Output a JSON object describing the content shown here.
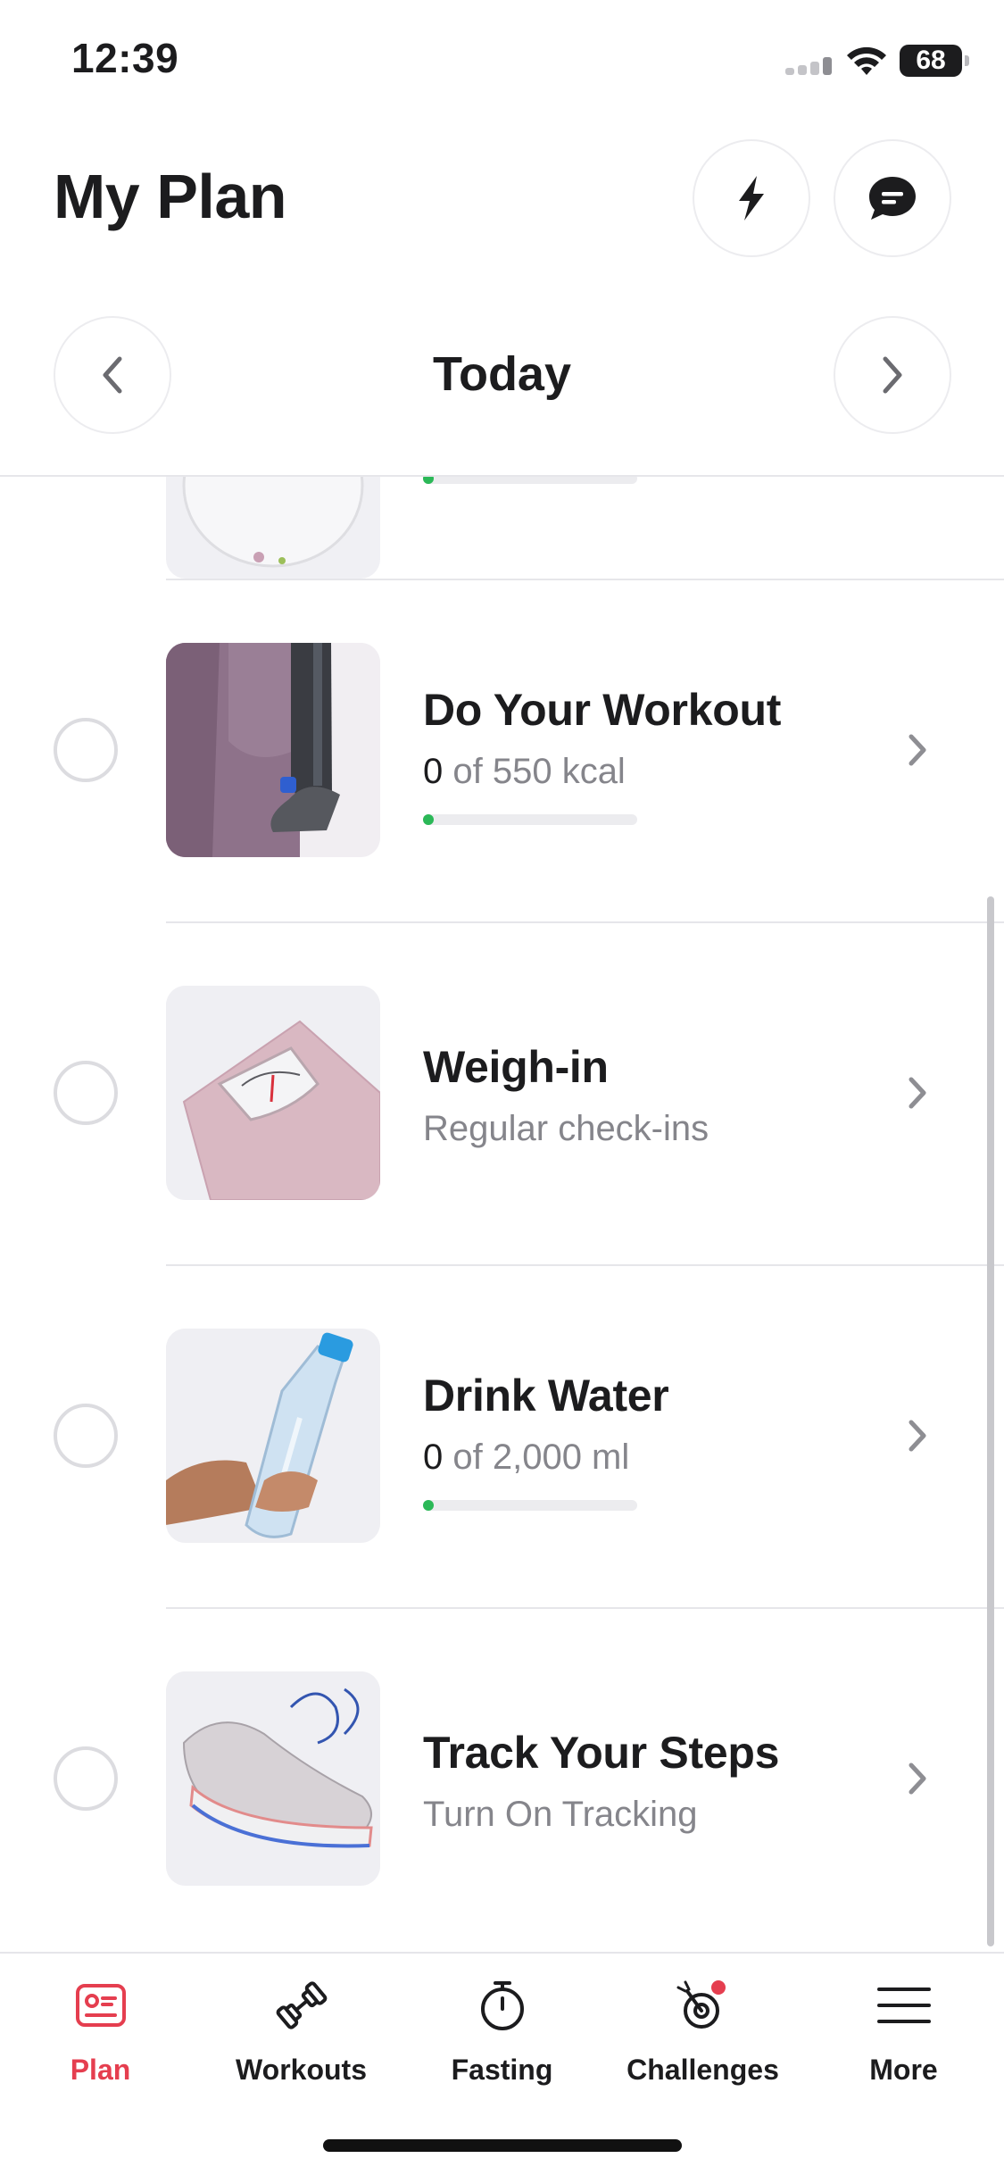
{
  "status_bar": {
    "time": "12:39",
    "battery": "68"
  },
  "header": {
    "title": "My Plan",
    "date_label": "Today"
  },
  "tasks": [
    {
      "title": "Do Your Workout",
      "value": "0",
      "sub_rest": " of 550 kcal",
      "progress": 0,
      "image": "prosthetic-leg-workout"
    },
    {
      "title": "Weigh-in",
      "subtitle": "Regular check-ins",
      "image": "weighing-scale"
    },
    {
      "title": "Drink Water",
      "value": "0",
      "sub_rest": " of 2,000 ml",
      "progress": 0,
      "image": "water-bottle"
    },
    {
      "title": "Track Your Steps",
      "subtitle": "Turn On Tracking",
      "image": "sneaker"
    }
  ],
  "tabbar": {
    "items": [
      {
        "label": "Plan",
        "icon": "plan-icon",
        "active": true
      },
      {
        "label": "Workouts",
        "icon": "dumbbell-icon"
      },
      {
        "label": "Fasting",
        "icon": "stopwatch-icon"
      },
      {
        "label": "Challenges",
        "icon": "target-icon"
      },
      {
        "label": "More",
        "icon": "menu-icon"
      }
    ]
  },
  "colors": {
    "accent": "#e53e4f",
    "progress": "#2bb857",
    "notification_dot": "#e53e4f"
  }
}
